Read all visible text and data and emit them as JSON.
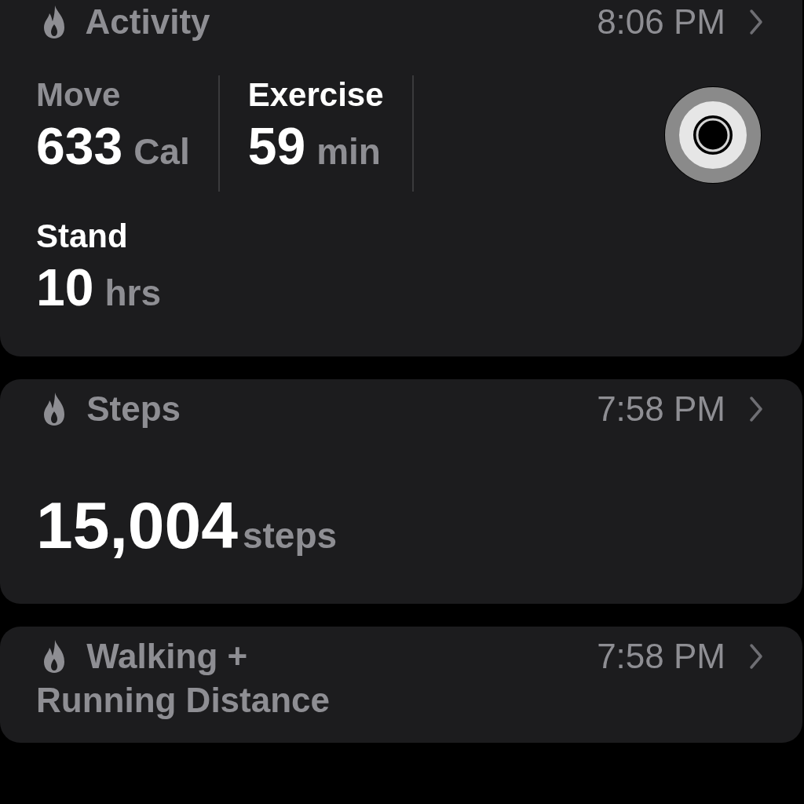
{
  "cards": [
    {
      "title": "Activity",
      "time": "8:06 PM",
      "metrics": [
        {
          "label": "Move",
          "value": "633",
          "unit": "Cal",
          "color": "#8e8e93"
        },
        {
          "label": "Exercise",
          "value": "59",
          "unit": "min",
          "color": "#ffffff"
        },
        {
          "label": "Stand",
          "value": "10",
          "unit": "hrs",
          "color": "#ffffff"
        }
      ]
    },
    {
      "title": "Steps",
      "time": "7:58 PM",
      "value": "15,004",
      "unit": "steps"
    },
    {
      "title": "Walking + Running Distance",
      "time": "7:58 PM"
    }
  ]
}
